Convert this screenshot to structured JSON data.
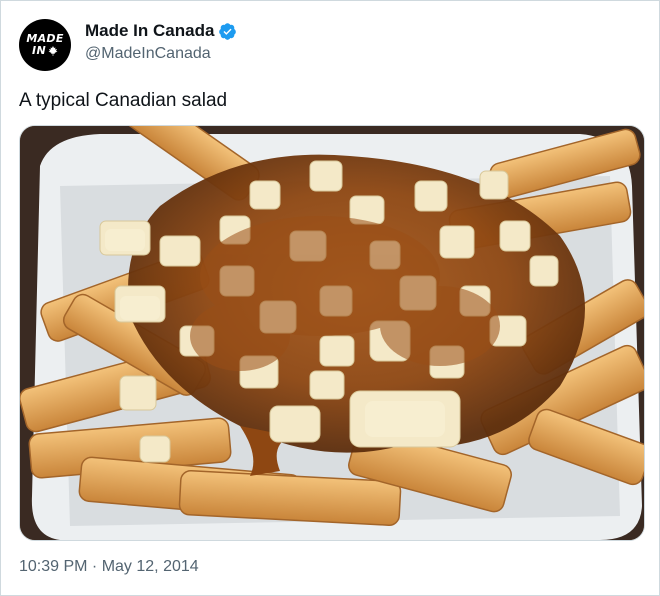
{
  "tweet": {
    "author": {
      "display_name": "Made In Canada",
      "handle": "@MadeInCanada",
      "verified": true,
      "avatar_line1": "MADE",
      "avatar_line2": "IN",
      "avatar_icon": "maple-leaf-icon"
    },
    "text": "A typical Canadian salad",
    "media": {
      "subject": "poutine-photo"
    },
    "timestamp": "10:39 PM · May 12, 2014"
  },
  "colors": {
    "verified_badge": "#1d9bf0",
    "muted_text": "#536471",
    "border": "#cfd9de"
  }
}
